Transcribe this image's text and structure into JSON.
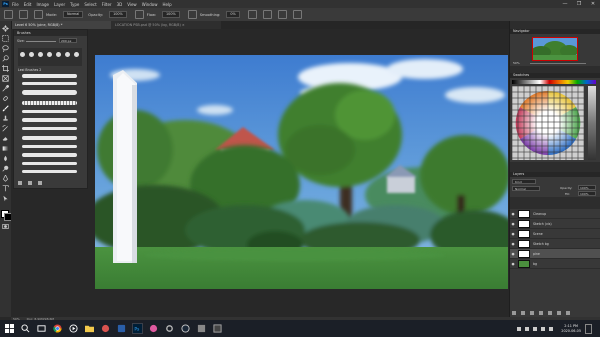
{
  "menubar": {
    "app_badge": "Ps",
    "items": [
      "File",
      "Edit",
      "Image",
      "Layer",
      "Type",
      "Select",
      "Filter",
      "3D",
      "View",
      "Window",
      "Help"
    ],
    "window_controls": [
      "—",
      "❐",
      "✕"
    ]
  },
  "options": {
    "mode_label": "Mode:",
    "mode_value": "Normal",
    "opacity_label": "Opacity:",
    "opacity_value": "100%",
    "flow_label": "Flow:",
    "flow_value": "100%",
    "smoothing_label": "Smoothing:",
    "smoothing_value": "0%"
  },
  "document": {
    "active_tab": "Level 6 50% (pine, RGB/8) *",
    "inactive_tab": "LOCATION PSB.psd @ 50% (bg, RGB/8) ×"
  },
  "brush_panel": {
    "title": "Brushes",
    "size_label": "Size:",
    "size_value": "200 px",
    "folder_label": "Lexi Brushes 2"
  },
  "navigator": {
    "title": "Navigator",
    "zoom": "50%"
  },
  "swatches": {
    "title": "Swatches"
  },
  "layers": {
    "title": "Layers",
    "kind_label": "Kind",
    "blend_mode": "Normal",
    "opacity_label": "Opacity:",
    "opacity_value": "100%",
    "fill_label": "Fill:",
    "fill_value": "100%",
    "items": [
      {
        "name": "Cleanup",
        "visible": true
      },
      {
        "name": "Sketch (vis)",
        "visible": true
      },
      {
        "name": "Scene",
        "visible": true
      },
      {
        "name": "Sketch bg",
        "visible": true
      },
      {
        "name": "pine",
        "visible": true,
        "selected": true
      },
      {
        "name": "bg",
        "visible": true
      }
    ]
  },
  "status": {
    "zoom": "50%",
    "doc_info": "Doc: 8.90M/98.6M"
  },
  "taskbar": {
    "time": "2:11 PM",
    "date": "2020-06-05"
  },
  "colors": {
    "sky": "#4b86cf",
    "grass": "#3d8a3a",
    "tree_dark": "#2d5e2a",
    "house_roof": "#c55a52"
  }
}
